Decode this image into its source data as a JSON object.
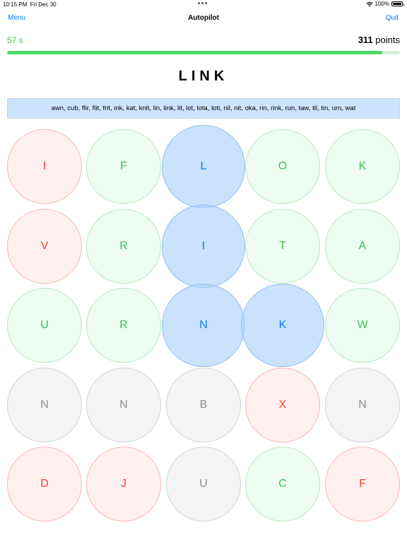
{
  "status": {
    "time": "10:15 PM",
    "date": "Fri Dec 30",
    "battery": "100%"
  },
  "nav": {
    "left": "Menu",
    "title": "Autopilot",
    "right": "Quit"
  },
  "game": {
    "timer": "57 s",
    "score": "311",
    "score_unit": "points",
    "progress": 0.955,
    "current_word": "LINK",
    "found_words": "awn, cub, flir, flit, frit, ink, kat, knit, lin, link, lit, lot, lota, loti, nil, nit, oka, rin, rink, run, taw, til, tin, urn, wat"
  },
  "colors": {
    "accent": "#007aff",
    "green": "#34c759",
    "red": "#ff3b30",
    "gray": "#8e8e93"
  },
  "grid": [
    [
      {
        "letter": "I",
        "state": "red"
      },
      {
        "letter": "F",
        "state": "green"
      },
      {
        "letter": "L",
        "state": "selected"
      },
      {
        "letter": "O",
        "state": "green"
      },
      {
        "letter": "K",
        "state": "green"
      }
    ],
    [
      {
        "letter": "V",
        "state": "red"
      },
      {
        "letter": "R",
        "state": "green"
      },
      {
        "letter": "I",
        "state": "selected"
      },
      {
        "letter": "T",
        "state": "green"
      },
      {
        "letter": "A",
        "state": "green"
      }
    ],
    [
      {
        "letter": "U",
        "state": "green"
      },
      {
        "letter": "R",
        "state": "green"
      },
      {
        "letter": "N",
        "state": "selected"
      },
      {
        "letter": "K",
        "state": "selected"
      },
      {
        "letter": "W",
        "state": "green"
      }
    ],
    [
      {
        "letter": "N",
        "state": "gray"
      },
      {
        "letter": "N",
        "state": "gray"
      },
      {
        "letter": "B",
        "state": "gray"
      },
      {
        "letter": "X",
        "state": "red"
      },
      {
        "letter": "N",
        "state": "gray"
      }
    ],
    [
      {
        "letter": "D",
        "state": "red"
      },
      {
        "letter": "J",
        "state": "red"
      },
      {
        "letter": "U",
        "state": "gray"
      },
      {
        "letter": "C",
        "state": "green"
      },
      {
        "letter": "F",
        "state": "red"
      }
    ]
  ]
}
